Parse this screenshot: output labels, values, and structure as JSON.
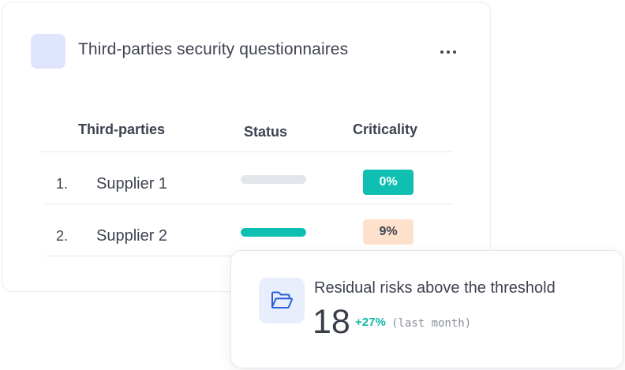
{
  "card": {
    "title": "Third-parties security questionnaires",
    "more_icon": "more-horizontal-icon"
  },
  "table": {
    "headers": [
      "Third-parties",
      "Status",
      "Criticality"
    ],
    "rows": [
      {
        "index": "1.",
        "name": "Supplier 1",
        "status_progress": 0,
        "criticality": "0%",
        "criticality_color": "#0fbfb2",
        "criticality_text_color": "#ffffff"
      },
      {
        "index": "2.",
        "name": "Supplier 2",
        "status_progress": 1,
        "criticality": "9%",
        "criticality_color": "#fde1cc",
        "criticality_text_color": "#3d4250"
      }
    ],
    "status_fill_color": "#0fbfb2",
    "status_track_color": "#e3e5ea"
  },
  "metric": {
    "icon": "folder-open-icon",
    "title": "Residual risks above the threshold",
    "value": "18",
    "delta": "+27%",
    "delta_color": "#14b8a6",
    "period": "(last month)"
  }
}
